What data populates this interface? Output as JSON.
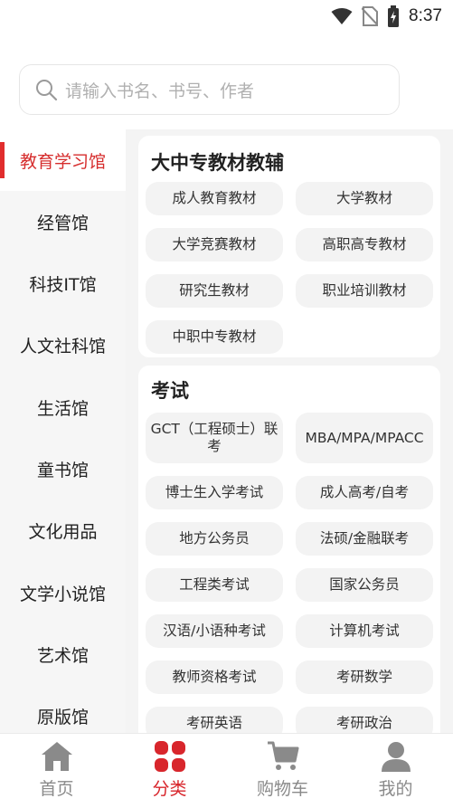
{
  "status": {
    "time": "8:37"
  },
  "search": {
    "placeholder": "请输入书名、书号、作者"
  },
  "sidebar": {
    "items": [
      {
        "label": "教育学习馆",
        "active": true
      },
      {
        "label": "经管馆"
      },
      {
        "label": "科技IT馆"
      },
      {
        "label": "人文社科馆"
      },
      {
        "label": "生活馆"
      },
      {
        "label": "童书馆"
      },
      {
        "label": "文化用品"
      },
      {
        "label": "文学小说馆"
      },
      {
        "label": "艺术馆"
      },
      {
        "label": "原版馆"
      }
    ]
  },
  "sections": [
    {
      "title": "大中专教材教辅",
      "chips": [
        "成人教育教材",
        "大学教材",
        "大学竞赛教材",
        "高职高专教材",
        "研究生教材",
        "职业培训教材",
        "中职中专教材"
      ]
    },
    {
      "title": "考试",
      "chips": [
        "GCT（工程硕士）联考",
        "MBA/MPA/MPACC",
        "博士生入学考试",
        "成人高考/自考",
        "地方公务员",
        "法硕/金融联考",
        "工程类考试",
        "国家公务员",
        "汉语/小语种考试",
        "计算机考试",
        "教师资格考试",
        "考研数学",
        "考研英语",
        "考研政治"
      ]
    }
  ],
  "bottom_nav": [
    {
      "label": "首页",
      "icon": "home-icon"
    },
    {
      "label": "分类",
      "icon": "category-icon",
      "active": true
    },
    {
      "label": "购物车",
      "icon": "cart-icon"
    },
    {
      "label": "我的",
      "icon": "profile-icon"
    }
  ],
  "colors": {
    "accent": "#d8262c",
    "inactive": "#8a8a8a",
    "sidebar_bg": "#f6f6f6",
    "chip_bg": "#f3f3f3"
  }
}
